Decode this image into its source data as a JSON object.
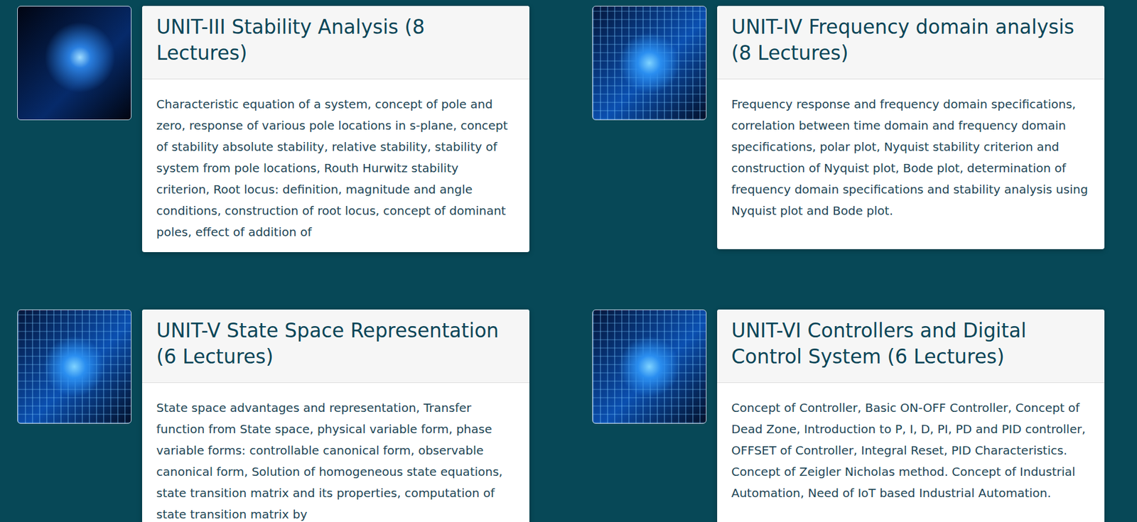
{
  "units": [
    {
      "title": "UNIT-III Stability Analysis (8 Lectures)",
      "description": "Characteristic equation of a system, concept of pole and zero, response of various pole locations in s-plane, concept of stability absolute stability, relative stability, stability of system from pole locations, Routh Hurwitz stability criterion, Root locus: definition, magnitude and angle conditions, construction of root locus, concept of dominant poles, effect of addition of"
    },
    {
      "title": "UNIT-IV Frequency domain analysis (8 Lectures)",
      "description": "Frequency response and frequency domain specifications, correlation between time domain and frequency domain specifications, polar plot, Nyquist stability criterion and construction of Nyquist plot, Bode plot, determination of frequency domain specifications and stability analysis using Nyquist plot and Bode plot."
    },
    {
      "title": "UNIT-V State Space Representation (6 Lectures)",
      "description": "State space advantages and representation, Transfer function from State space, physical variable form, phase variable forms: controllable canonical form, observable canonical form, Solution of homogeneous state equations, state transition matrix and its properties, computation of state transition matrix by"
    },
    {
      "title": "UNIT-VI Controllers and Digital Control System (6 Lectures)",
      "description": "Concept of Controller, Basic ON-OFF Controller, Concept of Dead Zone, Introduction to P, I, D, PI, PD and PID controller, OFFSET of Controller, Integral Reset, PID Characteristics. Concept of Zeigler Nicholas method. Concept of Industrial Automation, Need of IoT based Industrial Automation."
    }
  ]
}
